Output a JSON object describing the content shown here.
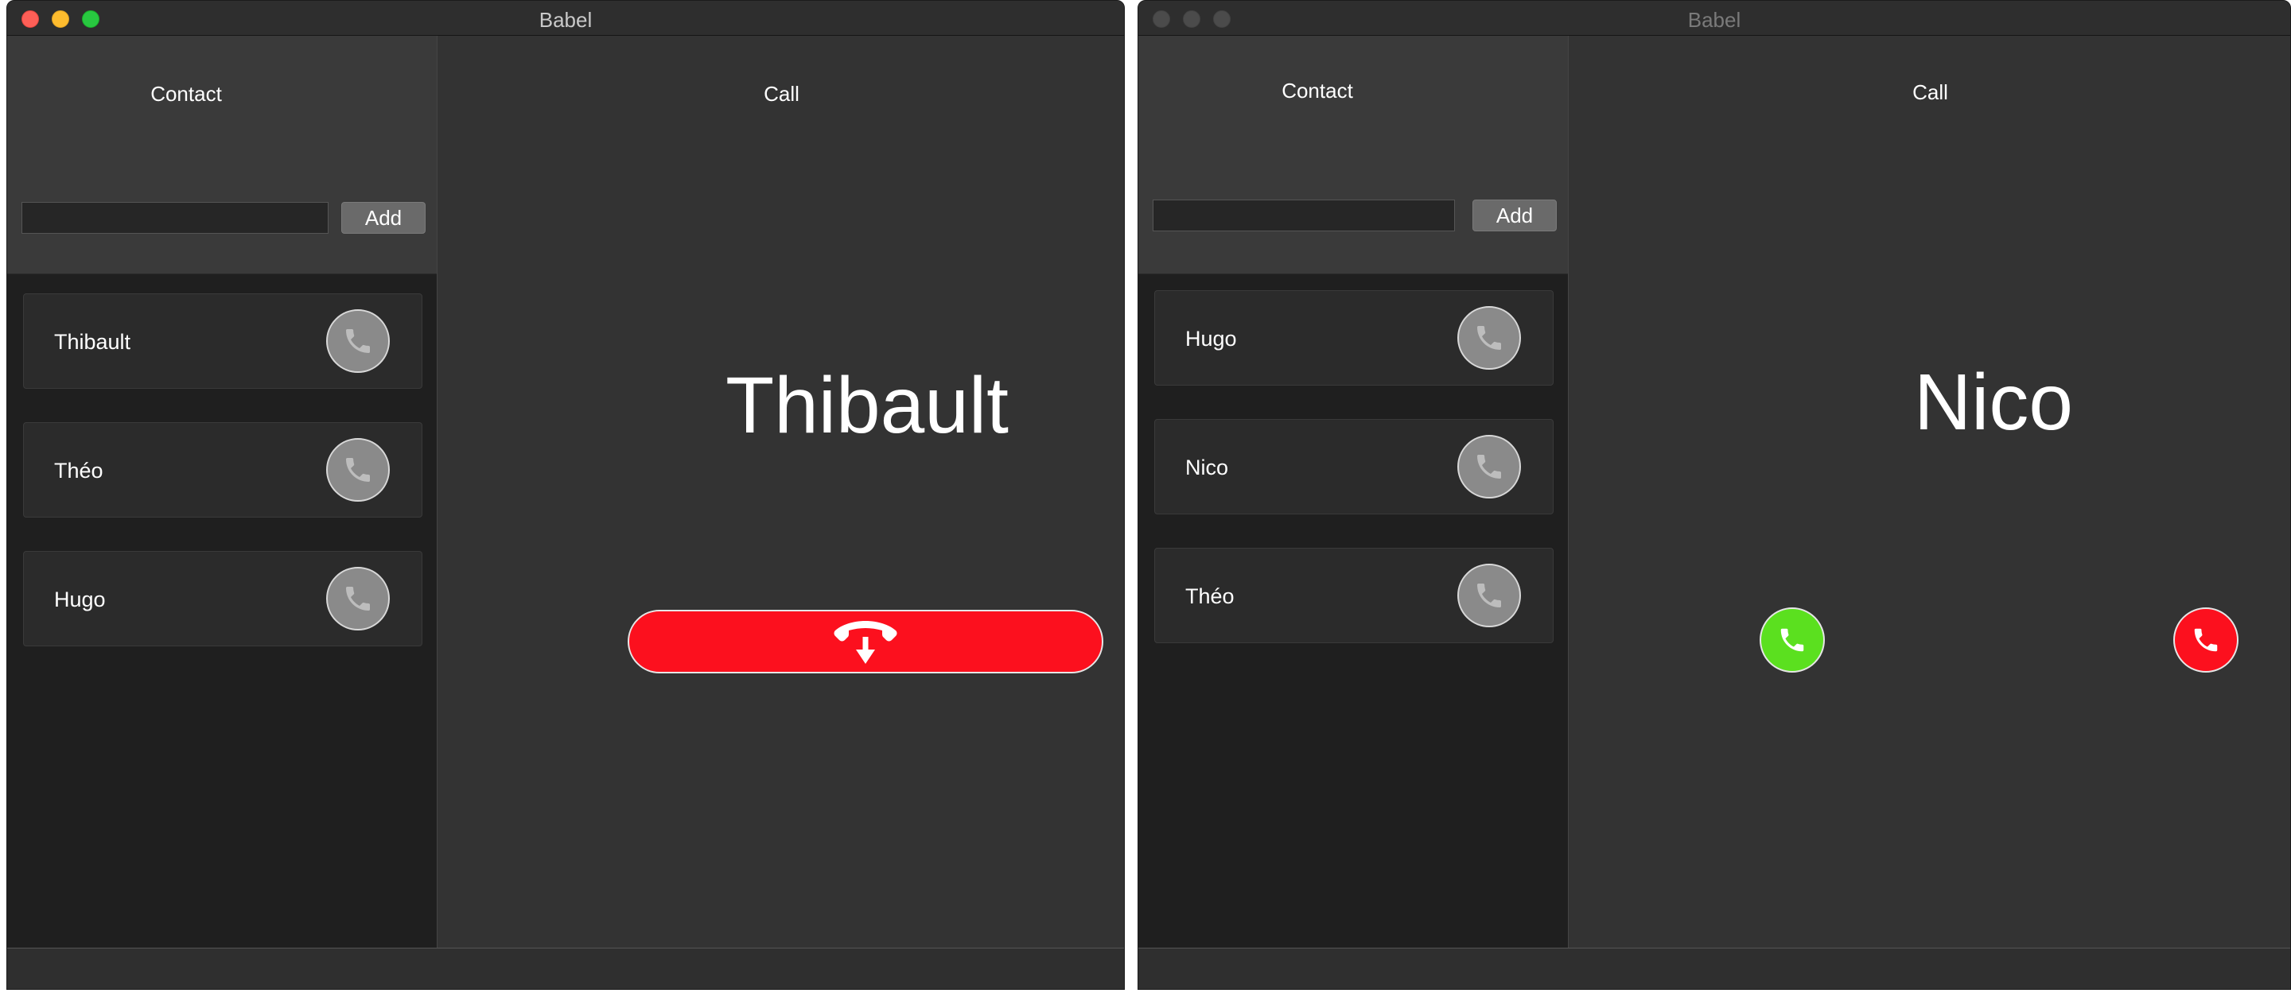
{
  "colors": {
    "hangup_red": "#fc101e",
    "accept_green": "#5be01f",
    "call_gray": "#8a8a8a"
  },
  "window_left": {
    "title": "Babel",
    "contact_panel": {
      "heading": "Contact",
      "input_value": "",
      "add_label": "Add",
      "contacts": [
        {
          "name": "Thibault",
          "call_icon": "phone-icon"
        },
        {
          "name": "Théo",
          "call_icon": "phone-icon"
        },
        {
          "name": "Hugo",
          "call_icon": "phone-icon"
        }
      ]
    },
    "call_panel": {
      "heading": "Call",
      "callee": "Thibault",
      "hangup_icon": "hang-up-icon"
    }
  },
  "window_right": {
    "title": "Babel",
    "contact_panel": {
      "heading": "Contact",
      "input_value": "",
      "add_label": "Add",
      "contacts": [
        {
          "name": "Hugo",
          "call_icon": "phone-icon"
        },
        {
          "name": "Nico",
          "call_icon": "phone-icon"
        },
        {
          "name": "Théo",
          "call_icon": "phone-icon"
        }
      ]
    },
    "call_panel": {
      "heading": "Call",
      "callee": "Nico",
      "accept_icon": "accept-call-icon",
      "decline_icon": "decline-call-icon"
    }
  }
}
